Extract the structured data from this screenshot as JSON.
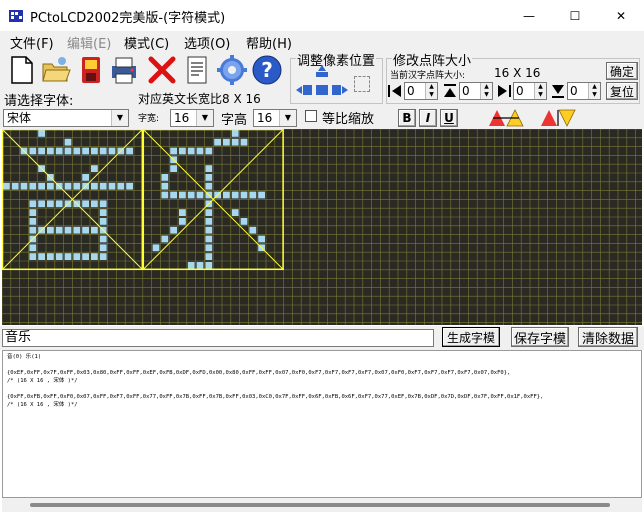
{
  "window": {
    "title": "PCtoLCD2002完美版-(字符模式)",
    "minimize": "—",
    "maximize": "☐",
    "close": "✕"
  },
  "menu": {
    "items": [
      {
        "label": "文件(F)",
        "enabled": true
      },
      {
        "label": "编辑(E)",
        "enabled": false
      },
      {
        "label": "模式(C)",
        "enabled": true
      },
      {
        "label": "选项(O)",
        "enabled": true
      },
      {
        "label": "帮助(H)",
        "enabled": true
      }
    ]
  },
  "toolbar": {
    "icons": [
      "new-file-icon",
      "open-folder-icon",
      "save-disk-icon",
      "print-icon",
      "delete-x-icon",
      "document-icon",
      "settings-gear-icon",
      "help-question-icon"
    ]
  },
  "font_panel": {
    "select_font_label": "请选择字体:",
    "font_value": "宋体",
    "ratio_label": "对应英文长宽比8 X 16",
    "width_label": "字宽:",
    "width_value": "16",
    "height_label": "字高",
    "height_value": "16",
    "proportional_label": "等比缩放",
    "bold": "B",
    "italic": "I",
    "underline": "U"
  },
  "pixel_adjust": {
    "title": "调整像素位置"
  },
  "dot_matrix": {
    "title": "修改点阵大小",
    "current_label": "当前汉字点阵大小:",
    "current_value": "16 X 16",
    "confirm": "确定",
    "reset": "复位",
    "spin_values": [
      "0",
      "0",
      "0",
      "0"
    ]
  },
  "preview": {
    "chars": [
      "音",
      "乐"
    ]
  },
  "bottom": {
    "input_text": "音乐",
    "generate_button": "生成字模",
    "save_button": "保存字模",
    "clear_button": "清除数据"
  },
  "output": {
    "header": "音(0) 乐(1)",
    "line1": "{0xEF,0xFF,0x7F,0xFF,0x03,0x80,0xFF,0xFF,0xEF,0xFB,0xDF,0xFD,0x00,0x80,0xFF,0xFF,0x07,0xF0,0xF7,0xF7,0xF7,0xF7,0x07,0xF0,0xF7,0xF7,0xF7,0xF7,0x07,0xF0},",
    "comment1": "/* (16 X 16 , 宋体 )*/",
    "line2": "{0xFF,0xFB,0xFF,0xF0,0x07,0xFF,0xF7,0xFF,0x77,0xFF,0x7B,0xFF,0x7B,0xFF,0x03,0xC0,0x7F,0xFF,0x6F,0xFB,0x6F,0xF7,0x77,0xEF,0x7B,0xDF,0x7D,0xDF,0x7F,0xFF,0x1F,0xFF},",
    "comment2": "/* (16 X 16 , 宋体 )*/"
  },
  "colors": {
    "grid_bg": "#2a2a22",
    "grid_line": "#7a7a3a",
    "pixel_on": "#a8d8f0",
    "guide": "#ffff33"
  }
}
